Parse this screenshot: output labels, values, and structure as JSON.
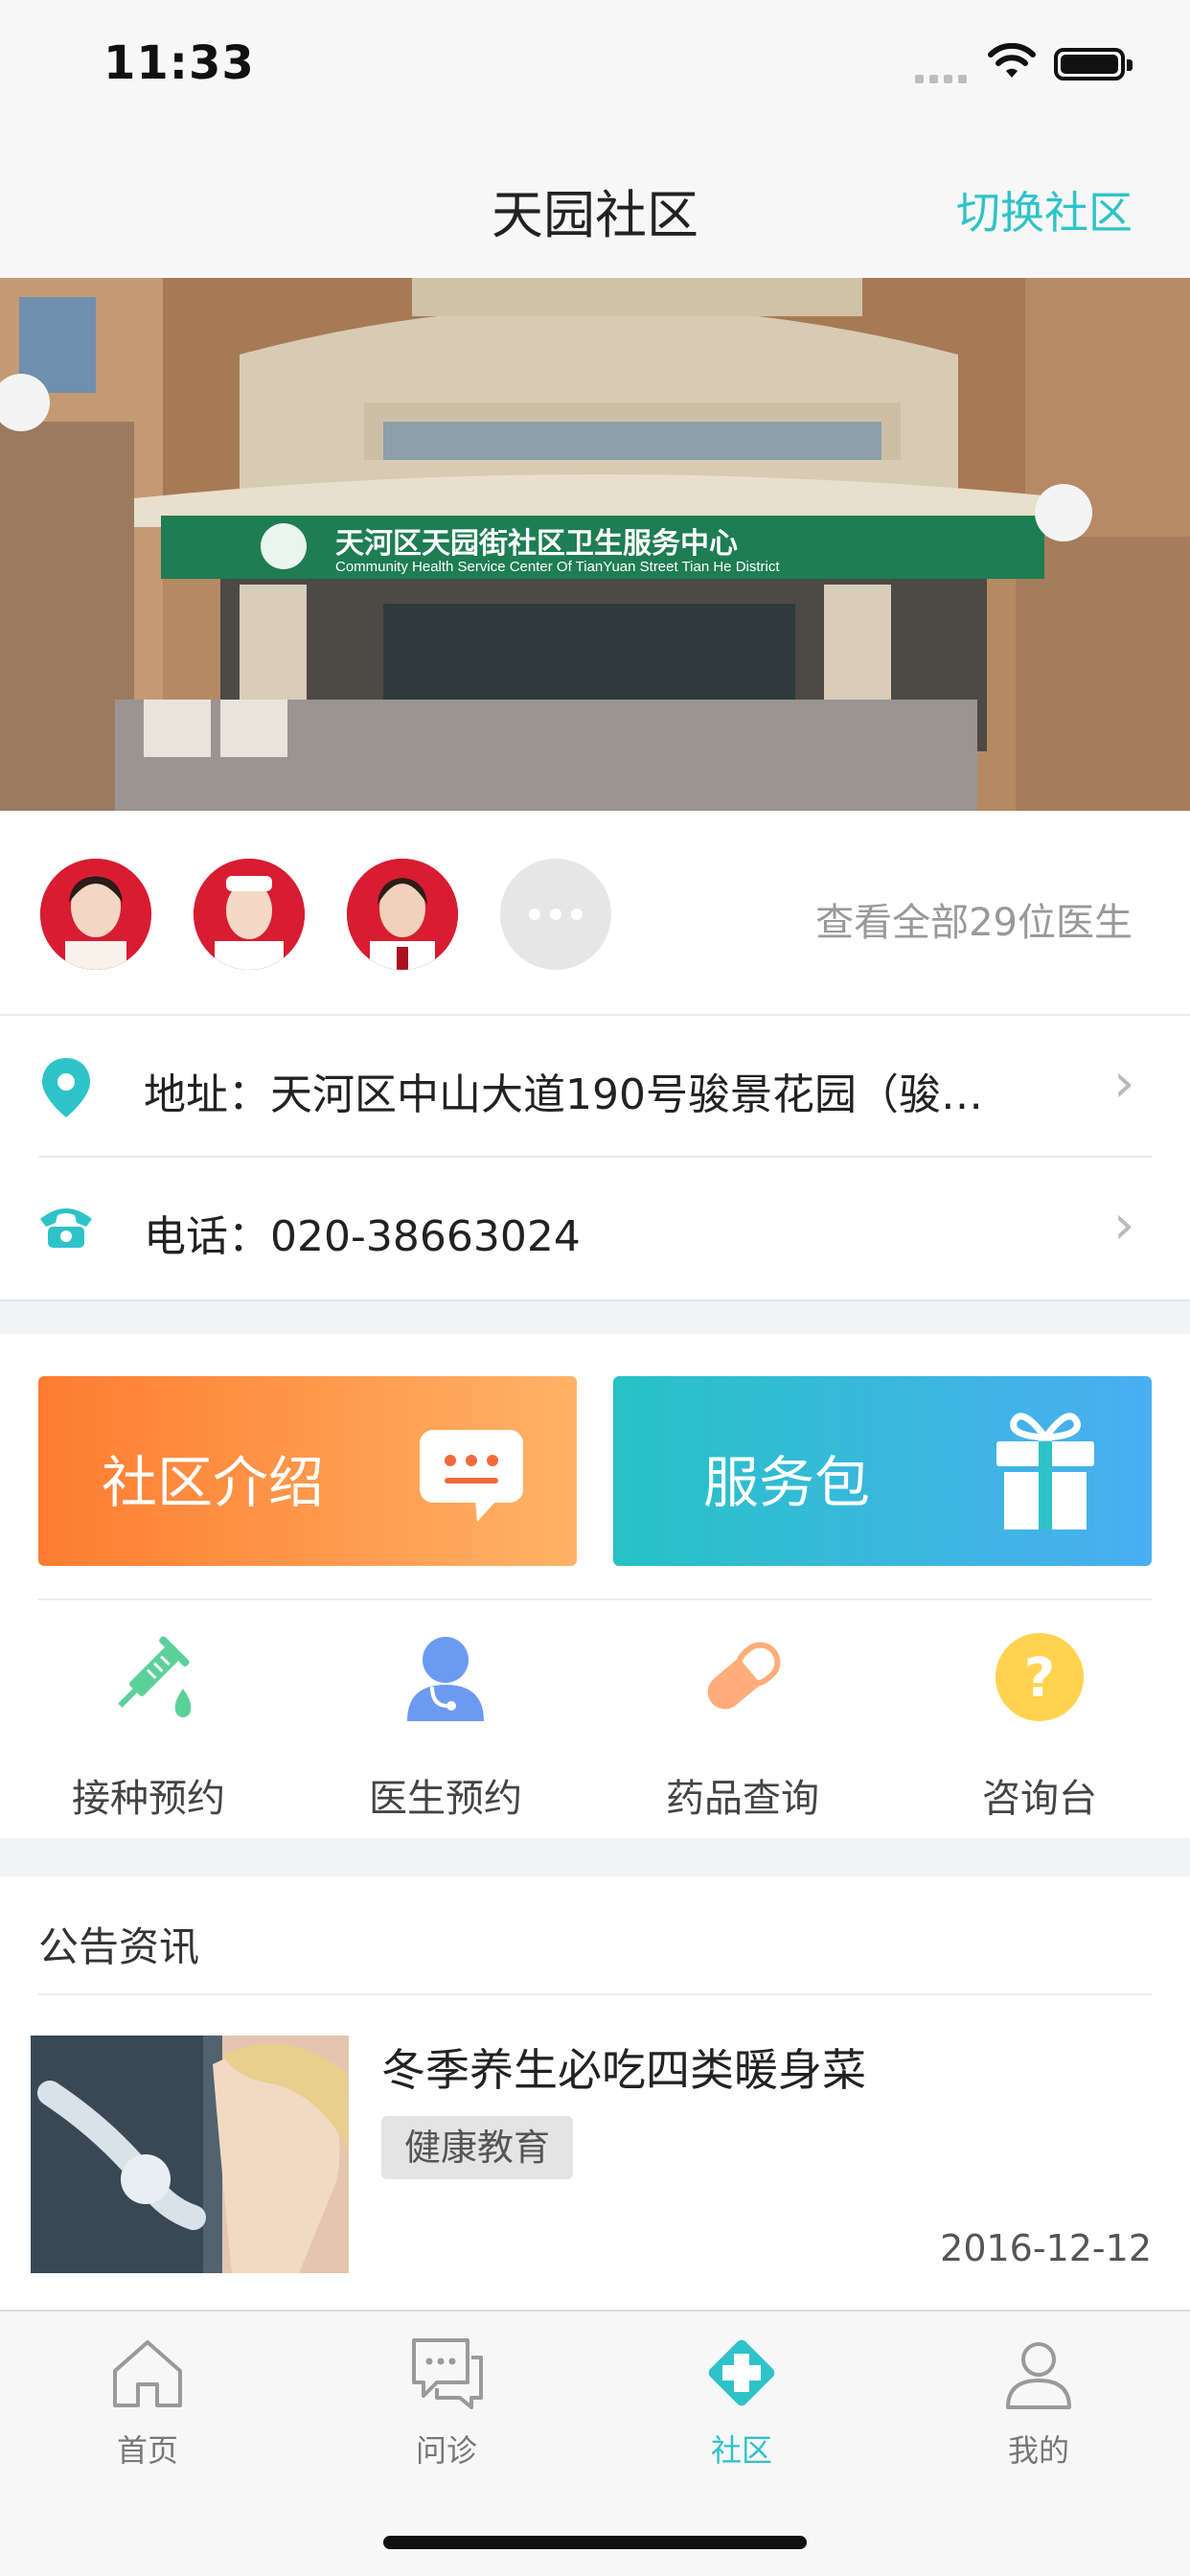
{
  "status_bar": {
    "time": "11:33"
  },
  "nav": {
    "title": "天园社区",
    "switch_label": "切换社区"
  },
  "banner": {
    "sign_cn": "天河区天园街社区卫生服务中心",
    "sign_en": "Community Health Service Center Of TianYuan Street Tian He District"
  },
  "doctors": {
    "avatars": [
      "doctor-avatar-1",
      "doctor-avatar-2",
      "doctor-avatar-3"
    ],
    "view_all_label": "查看全部29位医生"
  },
  "contact": {
    "address": "地址：天河区中山大道190号骏景花园（骏…",
    "phone": "电话：020-38663024"
  },
  "cards": {
    "intro_label": "社区介绍",
    "service_label": "服务包"
  },
  "services": [
    {
      "label": "接种预约",
      "icon": "syringe-icon",
      "color": "#5bd19a"
    },
    {
      "label": "医生预约",
      "icon": "doctor-icon",
      "color": "#6b9af1"
    },
    {
      "label": "药品查询",
      "icon": "pill-icon",
      "color": "#ffad7a"
    },
    {
      "label": "咨询台",
      "icon": "question-icon",
      "color": "#ffd34f"
    }
  ],
  "news": {
    "section_title": "公告资讯",
    "items": [
      {
        "title": "冬季养生必吃四类暖身菜",
        "tag": "健康教育",
        "date": "2016-12-12"
      }
    ]
  },
  "tabs": [
    {
      "label": "首页",
      "icon": "home-icon",
      "active": false
    },
    {
      "label": "问诊",
      "icon": "chat-icon",
      "active": false
    },
    {
      "label": "社区",
      "icon": "community-icon",
      "active": true
    },
    {
      "label": "我的",
      "icon": "profile-icon",
      "active": false
    }
  ],
  "colors": {
    "accent": "#2ec3c9",
    "intro_card_start": "#fe7c30",
    "intro_card_end": "#ffb366",
    "service_card_start": "#27c2c6",
    "service_card_end": "#4aaef2"
  }
}
